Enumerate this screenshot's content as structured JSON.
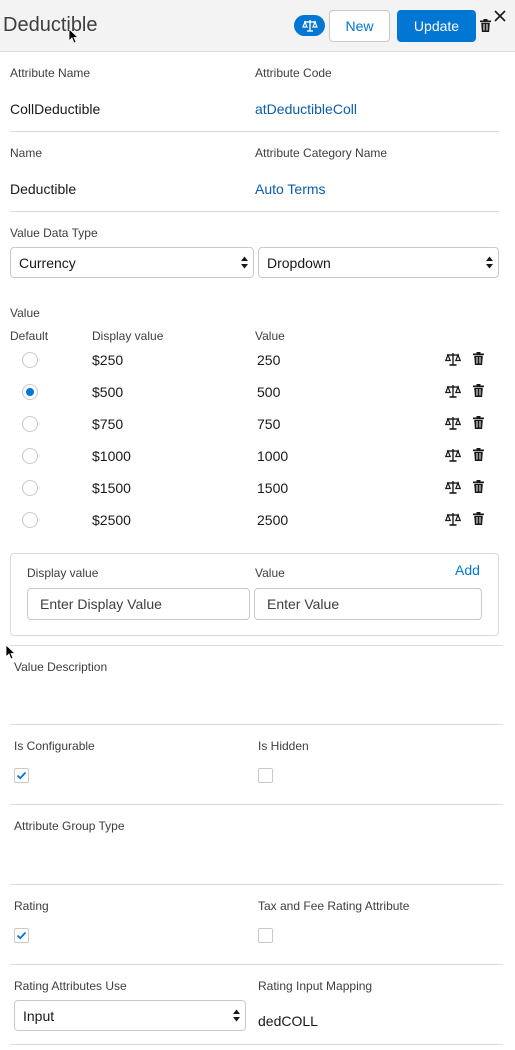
{
  "header": {
    "title": "Deductible",
    "new_label": "New",
    "update_label": "Update"
  },
  "colors": {
    "brand": "#0176d3",
    "link": "#0b5cab",
    "border": "#dddbda"
  },
  "icons": {
    "badge": "scale-icon",
    "delete": "trash-icon",
    "close": "close-icon",
    "radio": "radio-button",
    "check": "checkmark-icon",
    "select": "select-arrows-icon"
  },
  "fields": {
    "attribute_name_label": "Attribute Name",
    "attribute_name": "CollDeductible",
    "attribute_code_label": "Attribute Code",
    "attribute_code": "atDeductibleColl",
    "name_label": "Name",
    "name": "Deductible",
    "category_label": "Attribute Category Name",
    "category": "Auto Terms",
    "data_type_label": "Value Data Type",
    "data_type": "Currency",
    "input_type": "Dropdown"
  },
  "values": {
    "section_label": "Value",
    "col_default": "Default",
    "col_display": "Display value",
    "col_value": "Value",
    "rows": [
      {
        "display": "$250",
        "value": "250",
        "default": false
      },
      {
        "display": "$500",
        "value": "500",
        "default": true
      },
      {
        "display": "$750",
        "value": "750",
        "default": false
      },
      {
        "display": "$1000",
        "value": "1000",
        "default": false
      },
      {
        "display": "$1500",
        "value": "1500",
        "default": false
      },
      {
        "display": "$2500",
        "value": "2500",
        "default": false
      }
    ]
  },
  "add_value": {
    "display_label": "Display value",
    "value_label": "Value",
    "add_label": "Add",
    "display_placeholder": "Enter Display Value",
    "value_placeholder": "Enter Value"
  },
  "lower": {
    "value_description_label": "Value Description",
    "is_configurable_label": "Is Configurable",
    "is_configurable": true,
    "is_hidden_label": "Is Hidden",
    "is_hidden": false,
    "group_type_label": "Attribute Group Type",
    "rating_label": "Rating",
    "rating": true,
    "tax_fee_label": "Tax and Fee Rating Attribute",
    "tax_fee": false,
    "rating_use_label": "Rating Attributes Use",
    "rating_use": "Input",
    "rating_mapping_label": "Rating Input Mapping",
    "rating_mapping": "dedCOLL"
  }
}
